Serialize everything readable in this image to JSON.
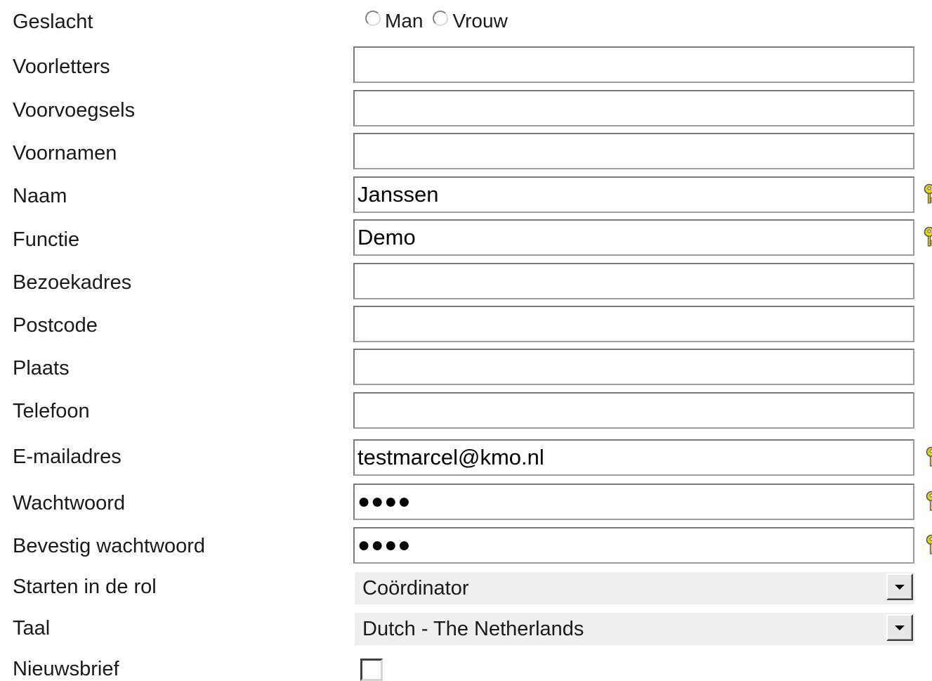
{
  "colors": {
    "key_icon": "#e8d800",
    "select_bg": "#efefef",
    "border": "#7a7a7a"
  },
  "gender": {
    "label": "Geslacht",
    "options": [
      "Man",
      "Vrouw"
    ]
  },
  "fields": {
    "initials": {
      "label": "Voorletters",
      "value": ""
    },
    "prefixes": {
      "label": "Voorvoegsels",
      "value": ""
    },
    "first_names": {
      "label": "Voornamen",
      "value": ""
    },
    "last_name": {
      "label": "Naam",
      "value": "Janssen",
      "required_icon": "key-icon"
    },
    "job_title": {
      "label": "Functie",
      "value": "Demo",
      "required_icon": "key-icon"
    },
    "visit_address": {
      "label": "Bezoekadres",
      "value": ""
    },
    "postal_code": {
      "label": "Postcode",
      "value": ""
    },
    "city": {
      "label": "Plaats",
      "value": ""
    },
    "phone": {
      "label": "Telefoon",
      "value": ""
    },
    "email": {
      "label": "E-mailadres",
      "value": "testmarcel@kmo.nl",
      "required_icon": "key-icon"
    },
    "password": {
      "label": "Wachtwoord",
      "value": "●●●●",
      "required_icon": "key-icon"
    },
    "confirm_password": {
      "label": "Bevestig wachtwoord",
      "value": "●●●●",
      "required_icon": "key-icon"
    }
  },
  "start_role": {
    "label": "Starten in de rol",
    "selected": "Coördinator"
  },
  "language": {
    "label": "Taal",
    "selected": "Dutch - The Netherlands"
  },
  "newsletter": {
    "label": "Nieuwsbrief",
    "checked": false
  }
}
